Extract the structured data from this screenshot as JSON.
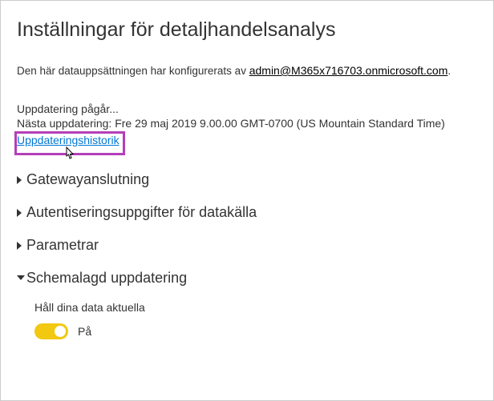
{
  "page": {
    "title": "Inställningar för detaljhandelsanalys"
  },
  "configured": {
    "prefix": "Den här datauppsättningen har konfigurerats av ",
    "email": "admin@M365x716703.onmicrosoft.com",
    "suffix": "."
  },
  "refresh": {
    "status": "Uppdatering pågår...",
    "next": "Nästa uppdatering: Fre 29 maj 2019 9.00.00 GMT-0700 (US Mountain Standard Time)",
    "history_link": "Uppdateringshistorik"
  },
  "sections": {
    "gateway": "Gatewayanslutning",
    "credentials": "Autentiseringsuppgifter för datakälla",
    "parameters": "Parametrar",
    "scheduled": "Schemalagd uppdatering"
  },
  "scheduled": {
    "keep_updated_label": "Håll dina data aktuella",
    "toggle_state": "På"
  }
}
